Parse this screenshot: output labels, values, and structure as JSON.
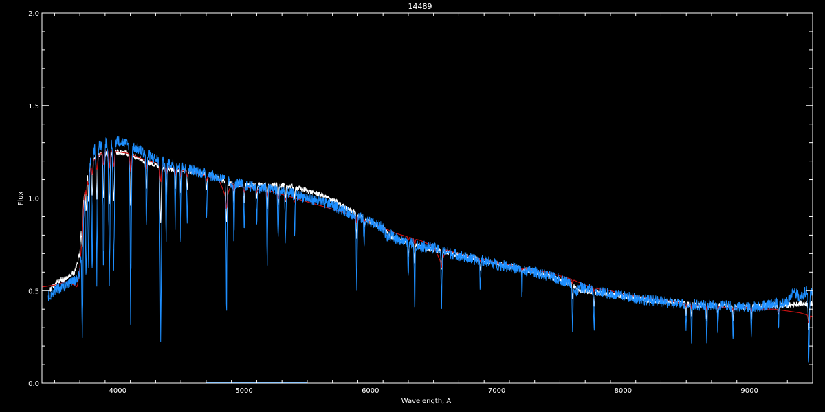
{
  "chart_data": {
    "type": "line",
    "title": "14489",
    "xlabel": "Wavelength, A",
    "ylabel": "Flux",
    "xlim": [
      3400,
      9500
    ],
    "ylim": [
      0.0,
      2.0
    ],
    "x_ticks": [
      4000,
      5000,
      6000,
      7000,
      8000,
      9000
    ],
    "x_tick_labels": [
      "4000",
      "5000",
      "6000",
      "7000",
      "8000",
      "9000"
    ],
    "y_ticks": [
      0.0,
      0.5,
      1.0,
      1.5,
      2.0
    ],
    "y_tick_labels": [
      "0.0",
      "0.5",
      "1.0",
      "1.5",
      "2.0"
    ],
    "grid": false,
    "background": "#000000",
    "axis_color": "#ffffff",
    "series": [
      {
        "color": "#ffffff",
        "x": [
          3460,
          3520,
          3600,
          3660,
          3700,
          3720,
          3760,
          3800,
          3900,
          4000,
          4100,
          4200,
          4300,
          4400,
          4500,
          4600,
          4700,
          4800,
          4860,
          4900,
          5000,
          5100,
          5200,
          5300,
          5400,
          5500,
          5600,
          5700,
          5800,
          5900,
          6000,
          6100,
          6150,
          6200,
          6300,
          6400,
          6500,
          6600,
          6700,
          6800,
          6900,
          7000,
          7100,
          7200,
          7300,
          7400,
          7500,
          7600,
          7650,
          7700,
          7800,
          7900,
          8000,
          8100,
          8200,
          8300,
          8400,
          8500,
          8600,
          8700,
          8800,
          8900,
          9000,
          9100,
          9200,
          9300,
          9400,
          9500
        ],
        "y": [
          0.5,
          0.55,
          0.57,
          0.6,
          0.7,
          0.95,
          1.15,
          1.22,
          1.24,
          1.25,
          1.24,
          1.2,
          1.18,
          1.16,
          1.15,
          1.14,
          1.13,
          1.11,
          1.08,
          1.08,
          1.07,
          1.07,
          1.07,
          1.07,
          1.06,
          1.04,
          1.02,
          0.99,
          0.95,
          0.91,
          0.87,
          0.84,
          0.8,
          0.78,
          0.76,
          0.74,
          0.72,
          0.71,
          0.69,
          0.68,
          0.66,
          0.65,
          0.63,
          0.62,
          0.6,
          0.58,
          0.56,
          0.53,
          0.5,
          0.5,
          0.49,
          0.48,
          0.47,
          0.46,
          0.45,
          0.44,
          0.44,
          0.43,
          0.42,
          0.42,
          0.42,
          0.41,
          0.41,
          0.42,
          0.42,
          0.42,
          0.43,
          0.43
        ]
      },
      {
        "color": "#cc1111",
        "x": [
          3400,
          3500,
          3600,
          3680,
          3700,
          3740,
          3800,
          3900,
          4000,
          4100,
          4200,
          4300,
          4400,
          4500,
          4600,
          4700,
          4800,
          4860,
          4900,
          5000,
          5100,
          5200,
          5300,
          5400,
          5500,
          5600,
          5700,
          5800,
          5900,
          6000,
          6100,
          6200,
          6300,
          6400,
          6500,
          6560,
          6600,
          6700,
          6800,
          6900,
          7000,
          7100,
          7200,
          7300,
          7400,
          7500,
          7600,
          7700,
          7800,
          7900,
          8000,
          8100,
          8200,
          8300,
          8400,
          8500,
          8600,
          8700,
          8800,
          8900,
          9000,
          9100,
          9200,
          9300,
          9400,
          9500
        ],
        "y": [
          0.52,
          0.53,
          0.55,
          0.52,
          0.62,
          1.05,
          1.2,
          1.26,
          1.25,
          1.24,
          1.21,
          1.19,
          1.17,
          1.15,
          1.14,
          1.12,
          1.1,
          1.0,
          1.08,
          1.06,
          1.05,
          1.04,
          1.02,
          1.0,
          0.98,
          0.96,
          0.94,
          0.92,
          0.9,
          0.87,
          0.84,
          0.81,
          0.79,
          0.77,
          0.74,
          0.65,
          0.72,
          0.7,
          0.68,
          0.67,
          0.65,
          0.64,
          0.62,
          0.61,
          0.6,
          0.58,
          0.56,
          0.53,
          0.51,
          0.5,
          0.48,
          0.47,
          0.46,
          0.45,
          0.44,
          0.43,
          0.42,
          0.42,
          0.41,
          0.41,
          0.41,
          0.4,
          0.4,
          0.39,
          0.38,
          0.36
        ]
      },
      {
        "color": "#1e8fff",
        "x": [
          3450,
          3500,
          3560,
          3620,
          3680,
          3700,
          3720,
          3740,
          3760,
          3780,
          3800,
          3850,
          3900,
          3950,
          4000,
          4050,
          4100,
          4150,
          4200,
          4250,
          4300,
          4350,
          4400,
          4450,
          4500,
          4550,
          4600,
          4650,
          4700,
          4750,
          4800,
          4850,
          4900,
          4950,
          5000,
          5100,
          5200,
          5300,
          5400,
          5500,
          5600,
          5700,
          5800,
          5900,
          6000,
          6100,
          6140,
          6160,
          6200,
          6300,
          6400,
          6500,
          6600,
          6700,
          6800,
          6900,
          7000,
          7100,
          7200,
          7300,
          7400,
          7500,
          7600,
          7620,
          7660,
          7700,
          7800,
          7900,
          8000,
          8100,
          8200,
          8300,
          8400,
          8500,
          8600,
          8700,
          8800,
          8900,
          9000,
          9100,
          9200,
          9300,
          9350,
          9400,
          9450,
          9500
        ],
        "y": [
          0.47,
          0.5,
          0.52,
          0.54,
          0.56,
          0.6,
          0.85,
          1.0,
          1.1,
          1.2,
          1.26,
          1.28,
          1.3,
          1.3,
          1.31,
          1.3,
          1.28,
          1.27,
          1.25,
          1.23,
          1.21,
          1.2,
          1.19,
          1.18,
          1.17,
          1.16,
          1.15,
          1.14,
          1.13,
          1.12,
          1.11,
          1.1,
          1.08,
          1.08,
          1.07,
          1.06,
          1.05,
          1.04,
          1.02,
          1.0,
          0.98,
          0.96,
          0.93,
          0.9,
          0.87,
          0.84,
          0.78,
          0.8,
          0.78,
          0.76,
          0.74,
          0.73,
          0.71,
          0.69,
          0.67,
          0.66,
          0.64,
          0.63,
          0.61,
          0.6,
          0.58,
          0.56,
          0.54,
          0.48,
          0.52,
          0.51,
          0.5,
          0.48,
          0.47,
          0.46,
          0.45,
          0.44,
          0.43,
          0.43,
          0.42,
          0.42,
          0.42,
          0.41,
          0.41,
          0.42,
          0.43,
          0.44,
          0.5,
          0.46,
          0.5,
          0.48
        ]
      }
    ],
    "absorption_lines": [
      {
        "x": 3720,
        "depth": 0.6
      },
      {
        "x": 3750,
        "depth": 0.5
      },
      {
        "x": 3770,
        "depth": 0.55
      },
      {
        "x": 3798,
        "depth": 0.6
      },
      {
        "x": 3835,
        "depth": 0.65
      },
      {
        "x": 3889,
        "depth": 0.7
      },
      {
        "x": 3934,
        "depth": 0.8
      },
      {
        "x": 3968,
        "depth": 0.75
      },
      {
        "x": 4102,
        "depth": 0.8
      },
      {
        "x": 4227,
        "depth": 0.4
      },
      {
        "x": 4340,
        "depth": 0.85
      },
      {
        "x": 4383,
        "depth": 0.4
      },
      {
        "x": 4455,
        "depth": 0.3
      },
      {
        "x": 4500,
        "depth": 0.35
      },
      {
        "x": 4550,
        "depth": 0.3
      },
      {
        "x": 4703,
        "depth": 0.25
      },
      {
        "x": 4861,
        "depth": 0.6
      },
      {
        "x": 4920,
        "depth": 0.3
      },
      {
        "x": 5000,
        "depth": 0.25
      },
      {
        "x": 5100,
        "depth": 0.2
      },
      {
        "x": 5183,
        "depth": 0.35
      },
      {
        "x": 5270,
        "depth": 0.3
      },
      {
        "x": 5328,
        "depth": 0.25
      },
      {
        "x": 5400,
        "depth": 0.2
      },
      {
        "x": 5892,
        "depth": 0.35
      },
      {
        "x": 5950,
        "depth": 0.15
      },
      {
        "x": 6300,
        "depth": 0.2
      },
      {
        "x": 6350,
        "depth": 0.3
      },
      {
        "x": 6563,
        "depth": 0.3
      },
      {
        "x": 6870,
        "depth": 0.15
      },
      {
        "x": 7200,
        "depth": 0.12
      },
      {
        "x": 7600,
        "depth": 0.2
      },
      {
        "x": 7770,
        "depth": 0.2
      },
      {
        "x": 8498,
        "depth": 0.15
      },
      {
        "x": 8542,
        "depth": 0.2
      },
      {
        "x": 8662,
        "depth": 0.2
      },
      {
        "x": 8750,
        "depth": 0.15
      },
      {
        "x": 8870,
        "depth": 0.18
      },
      {
        "x": 9014,
        "depth": 0.17
      },
      {
        "x": 9230,
        "depth": 0.15
      },
      {
        "x": 9470,
        "depth": 0.4
      }
    ]
  }
}
